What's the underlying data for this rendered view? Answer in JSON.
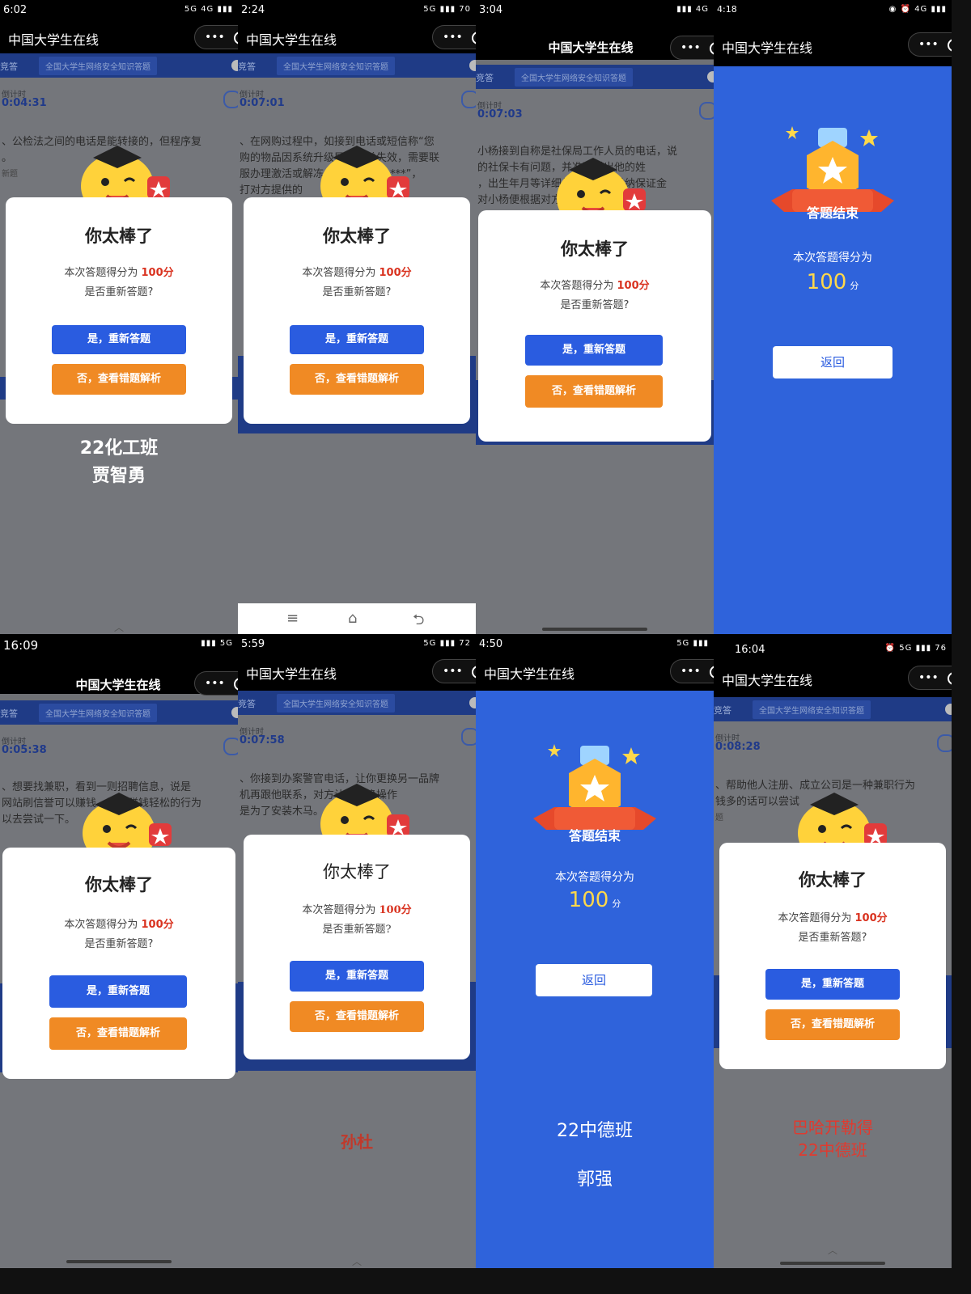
{
  "app": {
    "title": "中国大学生在线",
    "menu_dots": "•••",
    "tab_competition": "技竞答",
    "tab_competition_short": "竞答",
    "tab_title": "全国大学生网络安全知识答题",
    "timer_label": "倒计时"
  },
  "dialog": {
    "title": "你太棒了",
    "score_prefix": "本次答题得分为",
    "score": "100分",
    "retry_question": "是否重新答题?",
    "btn_retry": "是，重新答题",
    "btn_review": "否，查看错题解析"
  },
  "end_screen": {
    "ribbon": "答题结束",
    "score_label": "本次答题得分为",
    "score": "100",
    "unit": "分",
    "return": "返回"
  },
  "panels": [
    {
      "time": "6:02",
      "status_icons": "5G 4G ▮▮▮",
      "timer": "0:04:31",
      "question": "、公检法之间的电话是能转接的，但程序复",
      "question2": "。",
      "hint": "新题",
      "overlay_line1": "22化工班",
      "overlay_line2": "贾智勇"
    },
    {
      "time": "2:24",
      "status_icons": "5G ▮▮▮ 70",
      "timer": "0:07:01",
      "question": "、在网购过程中，如接到电话或短信称“您",
      "question2": "购的物品因系统升级导致订单失效，需要联",
      "question3": "服办理激活或解冻，请点击网址 ***”，",
      "question4": "打对方提供的"
    },
    {
      "time": "3:04",
      "status_icons": "▮▮▮ 4G",
      "timer": "0:07:03",
      "question": "小杨接到自称是社保局工作人员的电话，说",
      "question2": "的社保卡有问题，并准确说出他的姓",
      "question3": "，出生年月等详细信息，小杨缴纳保证金",
      "question4": "对小杨便根据对方指示操作。"
    },
    {
      "time": "4:18",
      "status_icons": "◉ ⏰ 4G ▮▮▮"
    },
    {
      "time": "16:09",
      "status_icons": "▮▮▮ 5G",
      "timer": "0:05:38",
      "question": "、想要找兼职，看到一则招聘信息，说是",
      "question2": "网站刷信誉可以赚钱，这种赚钱轻松的行为",
      "question3": "以去尝试一下。"
    },
    {
      "time": "5:59",
      "status_icons": "5G ▮▮▮ 72",
      "timer": "0:07:58",
      "question": "、你接到办案警官电话，让你更换另一品牌",
      "question2": "机再跟他联系，对方让你更换操作",
      "question3": "是为了安装木马。",
      "overlay_line1": "孙杜"
    },
    {
      "time": "4:50",
      "status_icons": "5G ▮▮▮",
      "overlay_line1": "22中德班",
      "overlay_line2": "郭强"
    },
    {
      "time": "16:04",
      "status_icons": "⏰ 5G ▮▮▮ 76",
      "timer": "0:08:28",
      "question": "、帮助他人注册、成立公司是一种兼职行为",
      "question2": "钱多的话可以尝试",
      "hint": "题",
      "overlay_line1": "巴哈开勒得",
      "overlay_line2": "22中德班"
    }
  ],
  "colors": {
    "accent_blue": "#2a5ce0",
    "accent_orange": "#f08a24",
    "score_red": "#d9321f",
    "end_bg": "#2f63db",
    "gold": "#ffd84a"
  },
  "icons": [
    "mascot-icon",
    "medal-icon",
    "star-icon",
    "capsule-close-icon",
    "timer-icon",
    "home-icon",
    "menu-icon",
    "back-icon"
  ]
}
